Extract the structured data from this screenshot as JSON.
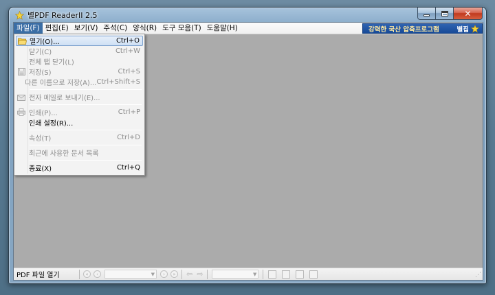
{
  "window": {
    "title": "별PDF ReaderII 2.5"
  },
  "menubar": {
    "items": [
      {
        "label": "파일(F)"
      },
      {
        "label": "편집(E)"
      },
      {
        "label": "보기(V)"
      },
      {
        "label": "주석(C)"
      },
      {
        "label": "양식(R)"
      },
      {
        "label": "도구 모음(T)"
      },
      {
        "label": "도움말(H)"
      }
    ],
    "banner_text": "강력한 국산 압축프로그램",
    "banner_link": "별집"
  },
  "file_menu": {
    "items": [
      {
        "label": "열기(O)...",
        "shortcut": "Ctrl+O",
        "icon": "folder-open-icon"
      },
      {
        "label": "닫기(C)",
        "shortcut": "Ctrl+W"
      },
      {
        "label": "전체 탭 닫기(L)",
        "shortcut": ""
      },
      {
        "label": "저장(S)",
        "shortcut": "Ctrl+S",
        "icon": "save-icon"
      },
      {
        "label": "다른 이름으로 저장(A)...",
        "shortcut": "Ctrl+Shift+S"
      },
      {
        "label": "전자 메일로 보내기(E)...",
        "shortcut": "",
        "icon": "email-icon"
      },
      {
        "label": "인쇄(P)...",
        "shortcut": "Ctrl+P",
        "icon": "print-icon"
      },
      {
        "label": "인쇄 설정(R)...",
        "shortcut": ""
      },
      {
        "label": "속성(T)",
        "shortcut": "Ctrl+D"
      },
      {
        "label": "최근에 사용한 문서 목록",
        "shortcut": ""
      },
      {
        "label": "종료(X)",
        "shortcut": "Ctrl+Q"
      }
    ]
  },
  "statusbar": {
    "text": "PDF 파일 열기"
  }
}
